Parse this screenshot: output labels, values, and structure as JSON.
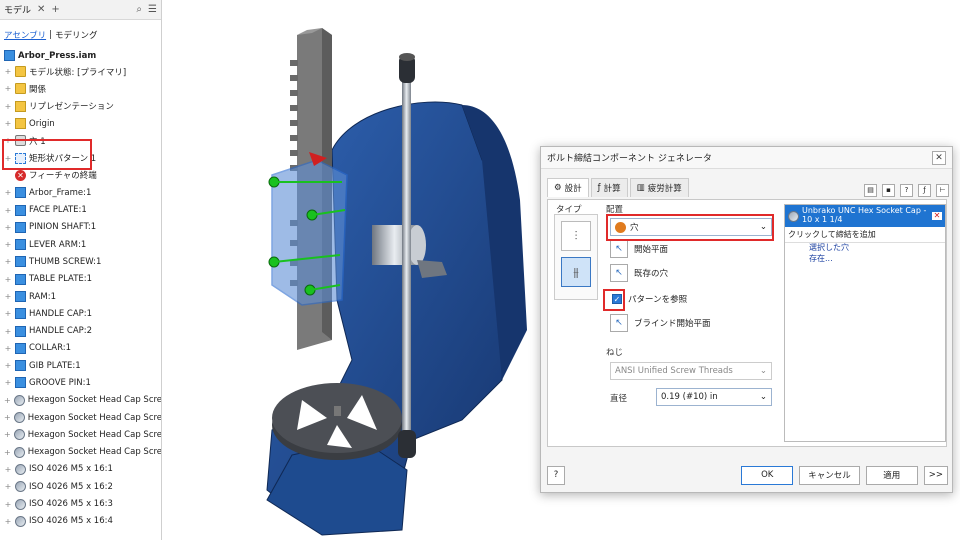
{
  "browser": {
    "tab_label": "モデル",
    "subtabs": [
      "アセンブリ",
      "モデリング"
    ],
    "root": "Arbor_Press.iam",
    "items": [
      {
        "label": "モデル状態: [プライマリ]",
        "icon": "folder-icon"
      },
      {
        "label": "関係",
        "icon": "folder-icon"
      },
      {
        "label": "リプレゼンテーション",
        "icon": "representation-icon"
      },
      {
        "label": "Origin",
        "icon": "origin-icon"
      },
      {
        "label": "穴 1",
        "icon": "hole-icon"
      },
      {
        "label": "矩形状パターン 1",
        "icon": "pattern-icon"
      },
      {
        "label": "フィーチャの終端",
        "icon": "error-icon"
      },
      {
        "label": "Arbor_Frame:1",
        "icon": "part-icon"
      },
      {
        "label": "FACE PLATE:1",
        "icon": "part-icon"
      },
      {
        "label": "PINION SHAFT:1",
        "icon": "part-icon"
      },
      {
        "label": "LEVER ARM:1",
        "icon": "part-icon"
      },
      {
        "label": "THUMB SCREW:1",
        "icon": "part-icon"
      },
      {
        "label": "TABLE PLATE:1",
        "icon": "part-icon"
      },
      {
        "label": "RAM:1",
        "icon": "part-icon"
      },
      {
        "label": "HANDLE CAP:1",
        "icon": "part-icon"
      },
      {
        "label": "HANDLE CAP:2",
        "icon": "part-icon"
      },
      {
        "label": "COLLAR:1",
        "icon": "part-icon"
      },
      {
        "label": "GIB PLATE:1",
        "icon": "part-icon"
      },
      {
        "label": "GROOVE PIN:1",
        "icon": "part-icon"
      },
      {
        "label": "Hexagon Socket Head Cap Screw - Inch",
        "icon": "bolt-icon"
      },
      {
        "label": "Hexagon Socket Head Cap Screw - Inch",
        "icon": "bolt-icon"
      },
      {
        "label": "Hexagon Socket Head Cap Screw - Inch",
        "icon": "bolt-icon"
      },
      {
        "label": "Hexagon Socket Head Cap Screw - Inch",
        "icon": "bolt-icon"
      },
      {
        "label": "ISO 4026 M5 x 16:1",
        "icon": "bolt-icon"
      },
      {
        "label": "ISO 4026 M5 x 16:2",
        "icon": "bolt-icon"
      },
      {
        "label": "ISO 4026 M5 x 16:3",
        "icon": "bolt-icon"
      },
      {
        "label": "ISO 4026 M5 x 16:4",
        "icon": "bolt-icon"
      }
    ]
  },
  "dialog": {
    "title": "ボルト締結コンポーネント ジェネレータ",
    "tabs": [
      "設計",
      "計算",
      "疲労計算"
    ],
    "type_label": "タイプ",
    "placement_label": "配置",
    "placement_value": "穴",
    "start_plane": "開始平面",
    "existing_hole": "既存の穴",
    "pattern_follow": "パターンを参照",
    "blind_start": "ブラインド開始平面",
    "thread_label": "ねじ",
    "thread_value": "ANSI Unified Screw Threads",
    "diameter_label": "直径",
    "diameter_value": "0.19 (#10) in",
    "component_line1": "Unbrako UNC Hex Socket Cap - In...",
    "component_line2": "10 x 1 1/4",
    "add_label": "クリックして締結を追加",
    "link1": "選択した穴",
    "link2": "存在...",
    "ok": "OK",
    "cancel": "キャンセル",
    "apply": "適用",
    "more": ">>",
    "help": "?"
  },
  "colors": {
    "frame": "#1e4b8f",
    "highlight": "#e02a2a",
    "selection": "#1f74d1"
  }
}
